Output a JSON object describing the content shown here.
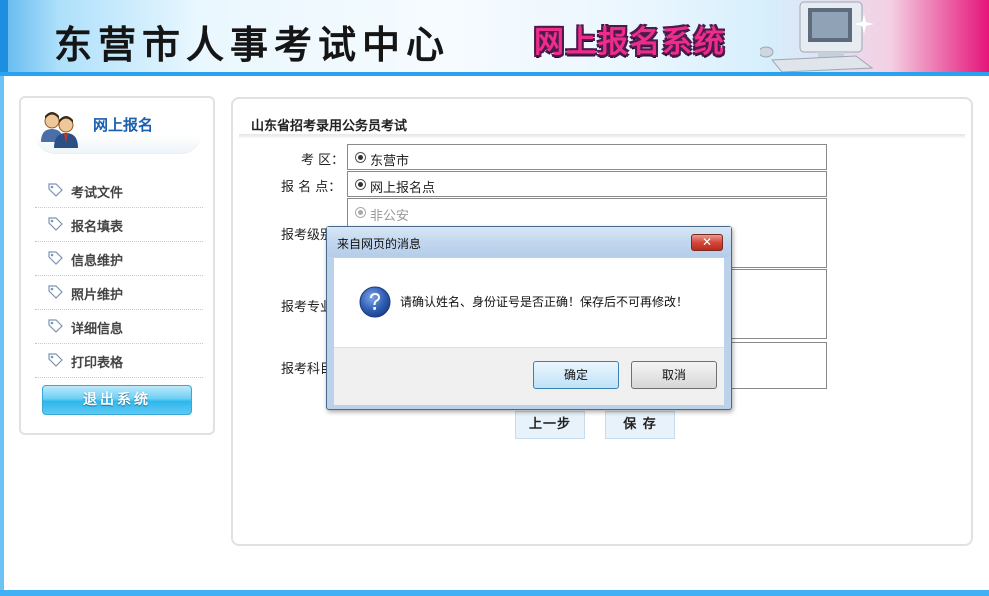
{
  "header": {
    "site_title": "东营市人事考试中心",
    "system_title": "网上报名系统"
  },
  "sidebar": {
    "title": "网上报名",
    "items": [
      {
        "label": "考试文件"
      },
      {
        "label": "报名填表"
      },
      {
        "label": "信息维护"
      },
      {
        "label": "照片维护"
      },
      {
        "label": "详细信息"
      },
      {
        "label": "打印表格"
      }
    ],
    "logout_label": "退出系统"
  },
  "main": {
    "title": "山东省招考录用公务员考试",
    "fields": {
      "exam_area_label": "考  区：",
      "exam_area_value": "东营市",
      "reg_point_label": "报 名 点：",
      "reg_point_value": "网上报名点",
      "level_label": "报考级别",
      "level_option": "非公安",
      "major_label": "报考专业",
      "subject_label": "报考科目"
    },
    "buttons": {
      "prev": "上一步",
      "save": "保  存"
    }
  },
  "dialog": {
    "title": "来自网页的消息",
    "message": "请确认姓名、身份证号是否正确！保存后不可再修改！",
    "ok_label": "确定",
    "cancel_label": "取消",
    "close_glyph": "✕"
  },
  "colors": {
    "accent_blue": "#29a2ef",
    "system_title_pink": "#ee2c8a",
    "close_red": "#d2483a"
  },
  "icons": [
    "users-icon",
    "tag-icon",
    "question-icon",
    "close-icon",
    "computer-icon"
  ]
}
